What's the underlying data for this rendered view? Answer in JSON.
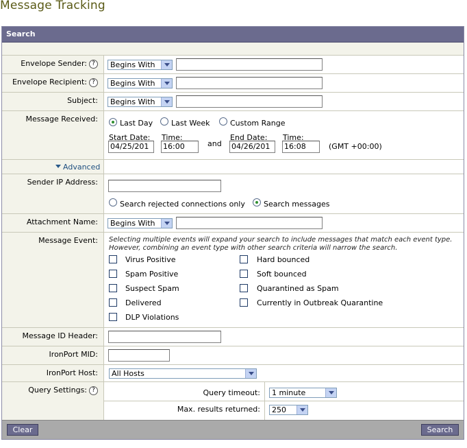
{
  "page": {
    "title": "Message Tracking"
  },
  "search": {
    "header": "Search",
    "envelope_sender": {
      "label": "Envelope Sender:",
      "operator": "Begins With",
      "value": ""
    },
    "envelope_recipient": {
      "label": "Envelope Recipient:",
      "operator": "Begins With",
      "value": ""
    },
    "subject": {
      "label": "Subject:",
      "operator": "Begins With",
      "value": ""
    },
    "message_received": {
      "label": "Message Received:",
      "options": [
        "Last Day",
        "Last Week",
        "Custom Range"
      ],
      "selected": "Last Day",
      "start_date_label": "Start Date:",
      "start_date": "04/25/201",
      "start_time_label": "Time:",
      "start_time": "16:00",
      "and_label": "and",
      "end_date_label": "End Date:",
      "end_date": "04/26/201",
      "end_time_label": "Time:",
      "end_time": "16:08",
      "timezone": "(GMT +00:00)"
    },
    "advanced_label": "Advanced",
    "sender_ip": {
      "label": "Sender IP Address:",
      "value": "",
      "options": [
        "Search rejected connections only",
        "Search messages"
      ],
      "selected": "Search messages"
    },
    "attachment_name": {
      "label": "Attachment Name:",
      "operator": "Begins With",
      "value": ""
    },
    "message_event": {
      "label": "Message Event:",
      "note": "Selecting multiple events will expand your search to include messages that match each event type. However, combining an event type with other search criteria will narrow the search.",
      "left_events": [
        "Virus Positive",
        "Spam Positive",
        "Suspect Spam",
        "Delivered",
        "DLP Violations"
      ],
      "right_events": [
        "Hard bounced",
        "Soft bounced",
        "Quarantined as Spam",
        "Currently in Outbreak Quarantine"
      ]
    },
    "message_id_header": {
      "label": "Message ID Header:",
      "value": ""
    },
    "ironport_mid": {
      "label": "IronPort MID:",
      "value": ""
    },
    "ironport_host": {
      "label": "IronPort Host:",
      "value": "All Hosts"
    },
    "query_settings": {
      "label": "Query Settings:",
      "timeout_label": "Query timeout:",
      "timeout_value": "1 minute",
      "max_results_label": "Max. results returned:",
      "max_results_value": "250"
    },
    "buttons": {
      "clear": "Clear",
      "search": "Search"
    }
  }
}
